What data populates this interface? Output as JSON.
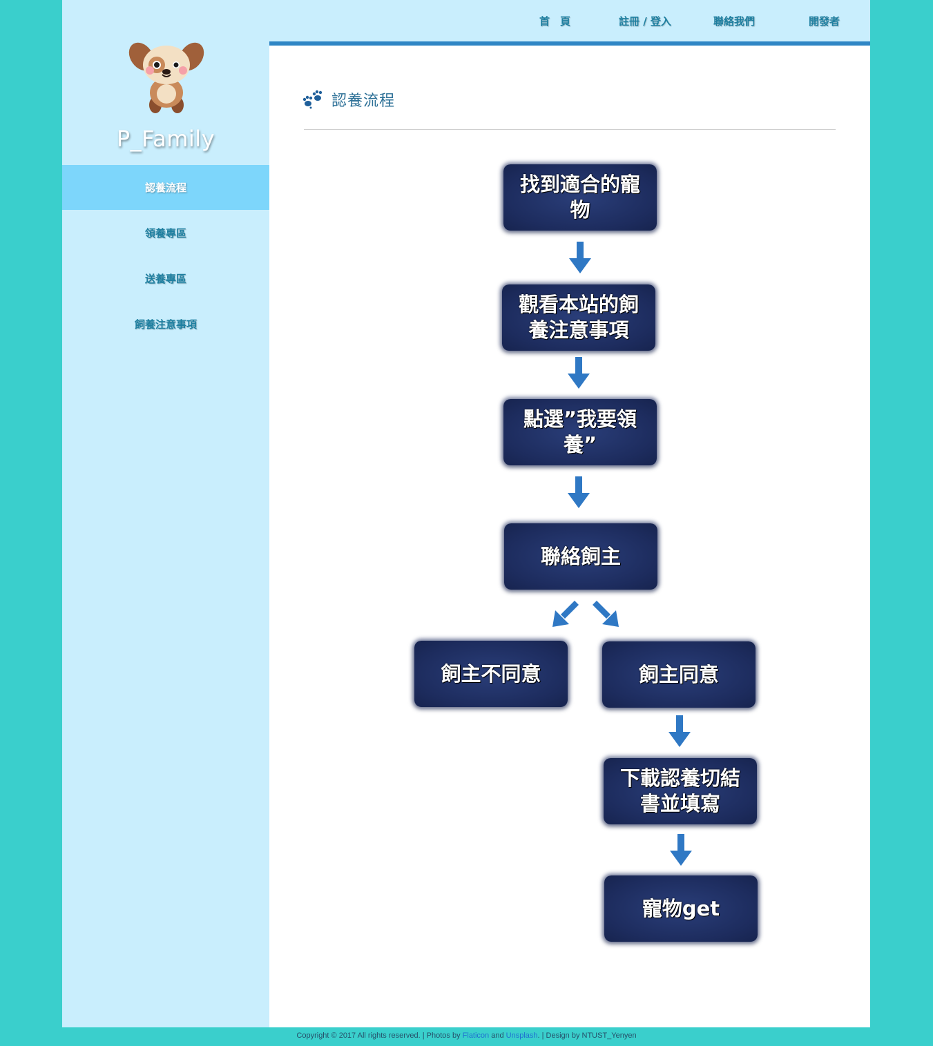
{
  "brand": {
    "name": "P_Family"
  },
  "sidebar": {
    "items": [
      {
        "label": "認養流程",
        "active": true
      },
      {
        "label": "領養專區",
        "active": false
      },
      {
        "label": "送養專區",
        "active": false
      },
      {
        "label": "飼養注意事項",
        "active": false
      }
    ]
  },
  "topnav": {
    "items": [
      {
        "label": "首　頁"
      },
      {
        "label": "註冊 / 登入"
      },
      {
        "label": "聯絡我們"
      },
      {
        "label": "開發者"
      }
    ]
  },
  "main": {
    "title": "認養流程",
    "title_icon": "paw-icon"
  },
  "flow": {
    "steps": [
      "找到適合的寵物",
      "觀看本站的飼養注意事項",
      "點選”我要領養”",
      "聯絡飼主",
      "飼主不同意",
      "飼主同意",
      "下載認養切結書並填寫",
      "寵物get"
    ]
  },
  "footer": {
    "prefix": "Copyright © 2017 All rights reserved. | Photos by ",
    "link1": "Flaticon",
    "and": " and ",
    "link2": "Unsplash",
    "suffix": ". | Design by NTUST_Yenyen"
  },
  "colors": {
    "background": "#3acfcc",
    "sidebar": "#c9eefd",
    "active_nav": "#7dd6fb",
    "topbar_line": "#2f86c5",
    "flow_box": "#1d2c5e",
    "arrow": "#2f78c4"
  }
}
